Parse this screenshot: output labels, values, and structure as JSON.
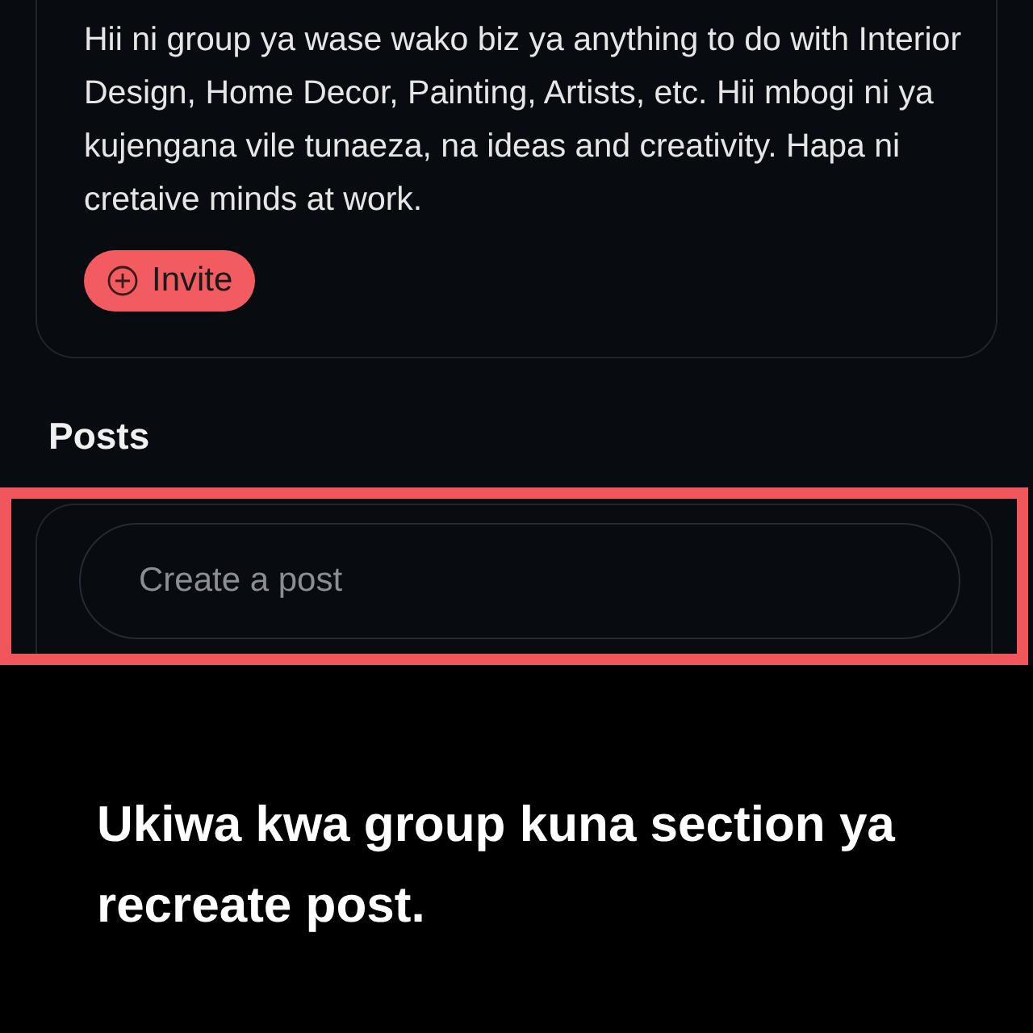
{
  "group_card": {
    "description": "Hii ni group ya wase wako biz ya anything to do with Interior Design, Home Decor, Painting, Artists, etc. Hii mbogi ni ya kujengana vile tunaeza, na ideas and creativity. Hapa ni cretaive minds at work.",
    "invite_button": "Invite"
  },
  "posts": {
    "heading": "Posts",
    "highlighted": true,
    "create_post": {
      "placeholder": "Create a post"
    }
  },
  "caption": "Ukiwa kwa group kuna section ya recreate post."
}
